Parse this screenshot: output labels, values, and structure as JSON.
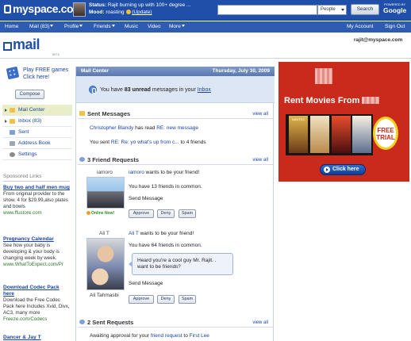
{
  "topbar": {
    "logo": "myspace.com",
    "status_label": "Status:",
    "status_text": "Rajit burning up with 100+ degree ...",
    "mood_label": "Mood:",
    "mood_text": "roasting",
    "update_link": "(Update)",
    "search_scope": "People",
    "search_button": "Search",
    "powered_by": "POWERED BY",
    "google": "Google"
  },
  "nav": {
    "items": [
      "Home",
      "Mail (83)",
      "Profile",
      "Friends",
      "Music",
      "Video",
      "More"
    ],
    "right": [
      "My Account",
      "Sign Out"
    ]
  },
  "mail": {
    "logo": "mail",
    "beta": "BETA",
    "user_email": "rajit@myspace.com"
  },
  "sidebar": {
    "promo": "Play FREE games",
    "promo_link": "Click here!",
    "compose": "Compose",
    "items": [
      {
        "label": "Mail Center"
      },
      {
        "label": "Inbox (83)"
      },
      {
        "label": "Sent"
      },
      {
        "label": "Address Book"
      },
      {
        "label": "Settings"
      }
    ],
    "sponsored_title": "Sponsored Links",
    "ads": [
      {
        "title": "Buy two and half men mug",
        "body": "From original provider to the show. 4 for $29.99,also plates and bowls",
        "url": "www.ffustore.com"
      },
      {
        "title": "Pregnancy Calendar",
        "body": "See how your baby is developing & your body is changing week by week.",
        "url": "www.WhatToExpect.com/Pr"
      },
      {
        "title": "Download Codec Pack here",
        "body": "Download the Free Codec Pack here Includes Xvid, Divx, AC3, many more",
        "url": "Freeze.com/Codecs"
      },
      {
        "title": "Dancer & Jay T"
      }
    ]
  },
  "main": {
    "header_title": "Mail Center",
    "header_date": "Thursday, July 30, 2009",
    "unread_pre": "You have ",
    "unread_count": "83 unread",
    "unread_post": " messages in your ",
    "unread_link": "Inbox",
    "sent_messages": {
      "title": "Sent Messages",
      "view_all": "view all",
      "line1_name": "Christopher Blandy",
      "line1_mid": " has read ",
      "line1_link": "RE: new message",
      "line2_pre": "You sent ",
      "line2_link": "RE: Re: yo what's up from c...",
      "line2_post": " to 4 friends"
    },
    "friend_requests": {
      "title": "3 Friend Requests",
      "view_all": "view all",
      "items": [
        {
          "name": "iamoro",
          "wants": " wants to be your friend!",
          "common": "You have 13 friends in common.",
          "send": "Send Message",
          "online": "Online Now!"
        },
        {
          "name": "Ali T",
          "wants": " wants to be your friend!",
          "common": "You have 64 friends in common.",
          "bubble": "Heard you're a cool guy Mr. Rajit. . want to be friends?",
          "send": "Send Message",
          "caption": "Ali Tahmasbi"
        }
      ],
      "buttons": [
        "Approve",
        "Deny",
        "Spam"
      ]
    },
    "sent_requests": {
      "title": "2 Sent Requests",
      "view_all": "view all",
      "line_pre": "Awaiting approval for your ",
      "line_link": "friend request",
      "line_mid": " to ",
      "line_name": "First Lee"
    }
  },
  "right_ad": {
    "title": "Rent Movies From",
    "trial": "FREE TRIAL",
    "click": "Click here",
    "poster_label": "NANTEC"
  },
  "colors": {
    "brand_blue": "#1f4fa8",
    "link": "#1a44a8",
    "ad_red": "#c92a1c"
  }
}
